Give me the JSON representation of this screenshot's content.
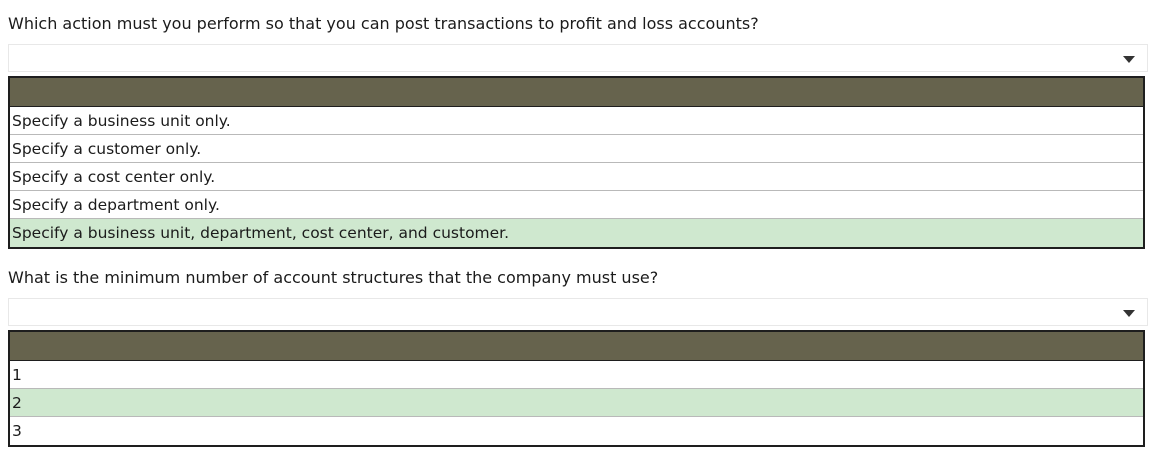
{
  "questions": [
    {
      "prompt": "Which action must you perform so that you can post transactions to profit and loss accounts?",
      "options": [
        "Specify a business unit only.",
        "Specify a customer only.",
        "Specify a cost center only.",
        "Specify a department only.",
        "Specify a business unit, department, cost center, and customer."
      ],
      "selected_index": 4
    },
    {
      "prompt": "What is the minimum number of account structures that the company must use?",
      "options": [
        "1",
        "2",
        "3"
      ],
      "selected_index": 1
    }
  ],
  "colors": {
    "header": "#66634d",
    "selected": "#cfe8cf",
    "border": "#1e1e1e"
  },
  "icons": {
    "dropdown": "chevron-down-icon"
  }
}
